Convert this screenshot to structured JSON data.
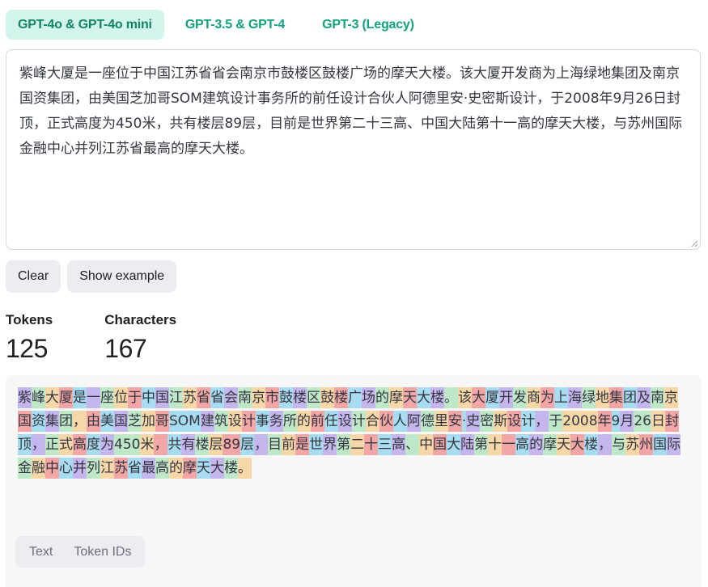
{
  "tabs": [
    {
      "label": "GPT-4o & GPT-4o mini",
      "active": true
    },
    {
      "label": "GPT-3.5 & GPT-4",
      "active": false
    },
    {
      "label": "GPT-3 (Legacy)",
      "active": false
    }
  ],
  "editor": {
    "text": "紫峰大厦是一座位于中国江苏省省会南京市鼓楼区鼓楼广场的摩天大楼。该大厦开发商为上海绿地集团及南京国资集团，由美国芝加哥SOM建筑设计事务所的前任设计合伙人阿德里安·史密斯设计，于2008年9月26日封顶，正式高度为450米，共有楼层89层，目前是世界第二十三高、中国大陆第十一高的摩天大楼，与苏州国际金融中心并列江苏省最高的摩天大楼。"
  },
  "buttons": {
    "clear": "Clear",
    "show_example": "Show example"
  },
  "stats": {
    "tokens_label": "Tokens",
    "tokens_value": "125",
    "characters_label": "Characters",
    "characters_value": "167"
  },
  "tokens": [
    "紫",
    "峰",
    "大",
    "厦",
    "是",
    "一",
    "座",
    "位",
    "于",
    "中",
    "国",
    "江",
    "苏",
    "省",
    "省",
    "会",
    "南",
    "京",
    "市",
    "鼓",
    "楼",
    "区",
    "鼓",
    "楼",
    "广",
    "场",
    "的",
    "摩",
    "天",
    "大",
    "楼",
    "。",
    "该",
    "大",
    "厦",
    "开",
    "发",
    "商",
    "为",
    "上",
    "海",
    "绿",
    "地",
    "集",
    "团",
    "及",
    "南",
    "京",
    "国",
    "资",
    "集",
    "团",
    "，",
    "由",
    "美",
    "国",
    "芝",
    "加",
    "哥",
    "SOM",
    "建",
    "筑",
    "设",
    "计",
    "事",
    "务",
    "所",
    "的",
    "前",
    "任",
    "设",
    "计",
    "合",
    "伙",
    "人",
    "阿",
    "德",
    "里",
    "安",
    "·",
    "史",
    "密",
    "斯",
    "设",
    "计",
    "，",
    "于",
    "2008",
    "年",
    "9",
    "月",
    "26",
    "日",
    "封",
    "顶",
    "，",
    "正",
    "式",
    "高",
    "度",
    "为",
    "450",
    "米",
    "，",
    "共",
    "有",
    "楼",
    "层",
    "89",
    "层",
    "，",
    "目",
    "前",
    "是",
    "世",
    "界",
    "第",
    "二",
    "十",
    "三",
    "高",
    "、",
    "中",
    "国",
    "大",
    "陆",
    "第",
    "十",
    "一",
    "高",
    "的",
    "摩",
    "天",
    "大",
    "楼",
    "，",
    "与",
    "苏",
    "州",
    "国",
    "际",
    "金",
    "融",
    "中",
    "心",
    "并",
    "列",
    "江",
    "苏",
    "省",
    "最",
    "高",
    "的",
    "摩",
    "天",
    "大",
    "楼",
    "。"
  ],
  "token_colors": [
    "#c5b6ed",
    "#bfe8c9",
    "#f6d7a8",
    "#f2a6a6",
    "#a8dcf0"
  ],
  "view_toggle": {
    "text": "Text",
    "token_ids": "Token IDs"
  },
  "colors": {
    "accent": "#10a37f",
    "active_tab_bg": "#d2f4ea",
    "button_bg": "#ececf1",
    "panel_bg": "#f7f7f8"
  }
}
